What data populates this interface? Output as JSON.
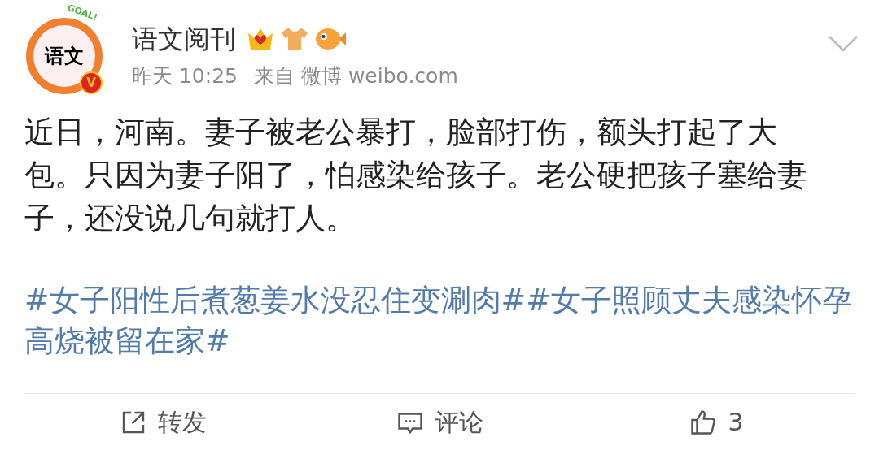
{
  "post": {
    "author": "语文阅刊",
    "avatar": {
      "text": "语文",
      "banner": "GOAL!",
      "verified_mark": "V"
    },
    "time": "昨天 10:25",
    "source": "来自 微博 weibo.com",
    "body": "近日，河南。妻子被老公暴打，脸部打伤，额头打起了大包。只因为妻子阳了，怕感染给孩子。老公硬把孩子塞给妻子，还没说几句就打人。",
    "topics": "#女子阳性后煮葱姜水没忍住变涮肉##女子照顾丈夫感染怀孕高烧被留在家#"
  },
  "actions": [
    {
      "kind": "repost",
      "label": "转发"
    },
    {
      "kind": "comment",
      "label": "评论"
    },
    {
      "kind": "like",
      "label": "3"
    }
  ]
}
